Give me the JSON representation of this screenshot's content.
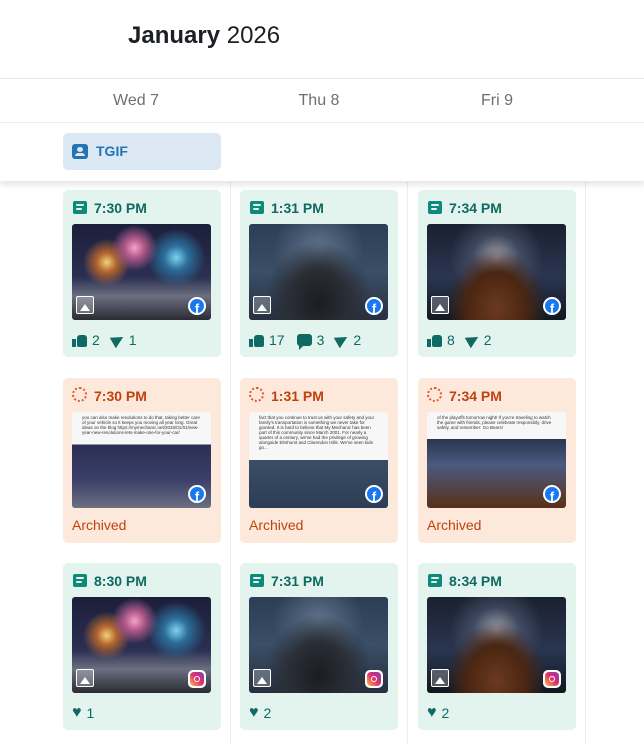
{
  "header": {
    "month": "January",
    "year": "2026"
  },
  "days": [
    "Wed 7",
    "Thu 8",
    "Fri 9"
  ],
  "all_day_event": {
    "label": "TGIF",
    "icon": "calendar-person-icon"
  },
  "colors": {
    "published_bg": "#e3f3ed",
    "archived_bg": "#fde9dc",
    "teal": "#0e6a62",
    "archived_text": "#c2410c",
    "event_chip_bg": "#dce8f4",
    "event_text": "#2373b5"
  },
  "rows": [
    {
      "status": "published",
      "posts": [
        {
          "time": "7:30 PM",
          "image": "fireworks-new-year",
          "network": "facebook-icon",
          "stats": {
            "likes": "2",
            "shares": "1"
          }
        },
        {
          "time": "1:31 PM",
          "image": "thank-you-car",
          "network": "facebook-icon",
          "stats": {
            "likes": "17",
            "comments": "3",
            "shares": "2"
          }
        },
        {
          "time": "7:34 PM",
          "image": "football-stadium",
          "network": "facebook-icon",
          "stats": {
            "likes": "8",
            "shares": "2"
          }
        }
      ]
    },
    {
      "status": "archived",
      "status_label": "Archived",
      "posts": [
        {
          "time": "7:30 PM",
          "image": "text-fireworks",
          "network": "facebook-icon",
          "caption": "you can also make resolutions to do that, taking better care of your vehicle so it keeps you moving all year long. Great ideas on the blog https://mymechanic.net/2026/01/01/new-year-new-resolutions-lets-make-one-for-your-car/"
        },
        {
          "time": "1:31 PM",
          "image": "text-thank-you",
          "network": "facebook-icon",
          "caption": "fact that you continue to trust us with your safety and your family's transportation is something we never take for granted. It is hard to believe that My Mechanic has been part of this community since March 2001. For nearly a quarter of a century, we've had the privilege of growing alongside Elmhurst and Clarendon Hills. We've seen kids go..."
        },
        {
          "time": "7:34 PM",
          "image": "text-football",
          "network": "facebook-icon",
          "caption": "of the playoffs tomorrow night! If you're traveling to watch the game with friends, please celebrate responsibly, drive safely, and remember: Go Bears!"
        }
      ]
    },
    {
      "status": "published",
      "posts": [
        {
          "time": "8:30 PM",
          "image": "fireworks-new-year",
          "network": "instagram-icon",
          "stats": {
            "hearts": "1"
          }
        },
        {
          "time": "7:31 PM",
          "image": "thank-you-car",
          "network": "instagram-icon",
          "stats": {
            "hearts": "2"
          }
        },
        {
          "time": "8:34 PM",
          "image": "football-stadium",
          "network": "instagram-icon",
          "stats": {
            "hearts": "2"
          }
        }
      ]
    }
  ]
}
